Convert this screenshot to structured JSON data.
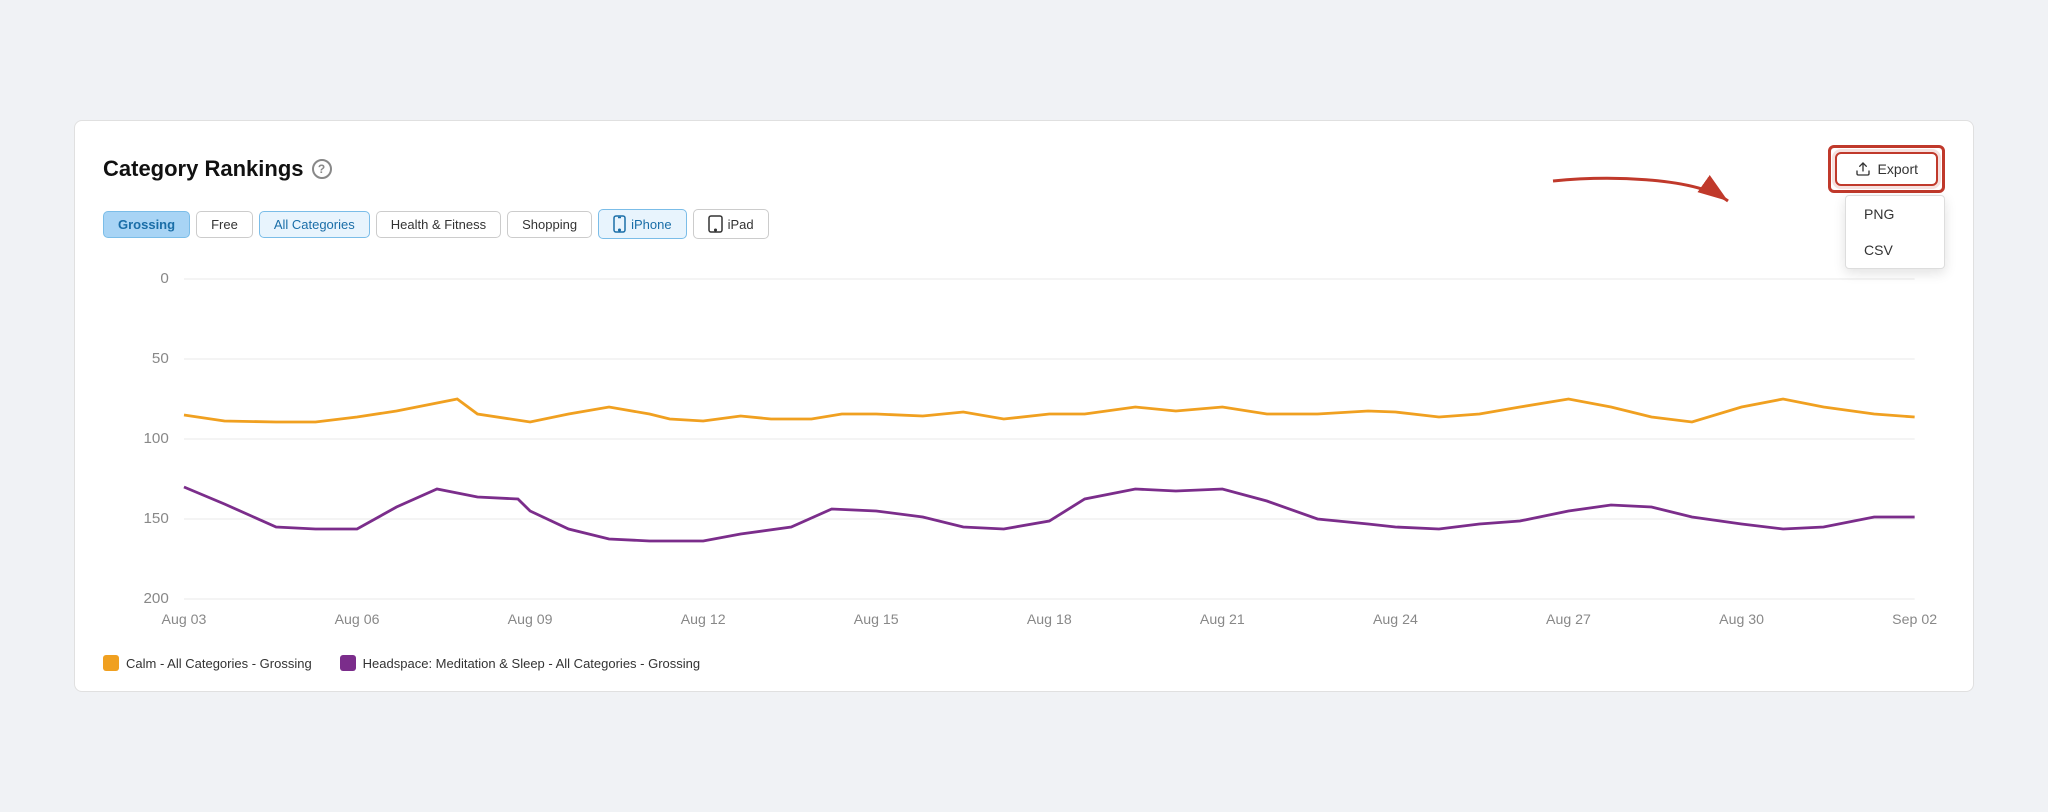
{
  "title": "Category Rankings",
  "help_label": "?",
  "filters": [
    {
      "id": "grossing",
      "label": "Grossing",
      "active": true,
      "outline": false,
      "icon": false
    },
    {
      "id": "free",
      "label": "Free",
      "active": false,
      "outline": false,
      "icon": false
    },
    {
      "id": "all-categories",
      "label": "All Categories",
      "active": false,
      "outline": true,
      "icon": false
    },
    {
      "id": "health-fitness",
      "label": "Health & Fitness",
      "active": false,
      "outline": false,
      "icon": false
    },
    {
      "id": "shopping",
      "label": "Shopping",
      "active": false,
      "outline": false,
      "icon": false
    },
    {
      "id": "iphone",
      "label": "iPhone",
      "active": false,
      "outline": true,
      "icon": true,
      "icon_type": "iphone"
    },
    {
      "id": "ipad",
      "label": "iPad",
      "active": false,
      "outline": false,
      "icon": true,
      "icon_type": "ipad"
    }
  ],
  "export": {
    "label": "Export",
    "icon": "upload-icon",
    "dropdown": [
      "PNG",
      "CSV"
    ]
  },
  "chart": {
    "y_labels": [
      "0",
      "50",
      "100",
      "150",
      "200"
    ],
    "x_labels": [
      "Aug 03",
      "Aug 06",
      "Aug 09",
      "Aug 12",
      "Aug 15",
      "Aug 18",
      "Aug 21",
      "Aug 24",
      "Aug 27",
      "Aug 30",
      "Sep 02"
    ],
    "series": [
      {
        "name": "Calm - All Categories - Grossing",
        "color": "#f0a020",
        "legend_color": "#f0a020"
      },
      {
        "name": "Headspace: Meditation & Sleep - All Categories - Grossing",
        "color": "#7b2d8b",
        "legend_color": "#7b2d8b"
      }
    ]
  },
  "legend": [
    {
      "label": "Calm - All Categories - Grossing",
      "color": "#f0a020"
    },
    {
      "label": "Headspace: Meditation & Sleep - All Categories - Grossing",
      "color": "#7b2d8b"
    }
  ]
}
